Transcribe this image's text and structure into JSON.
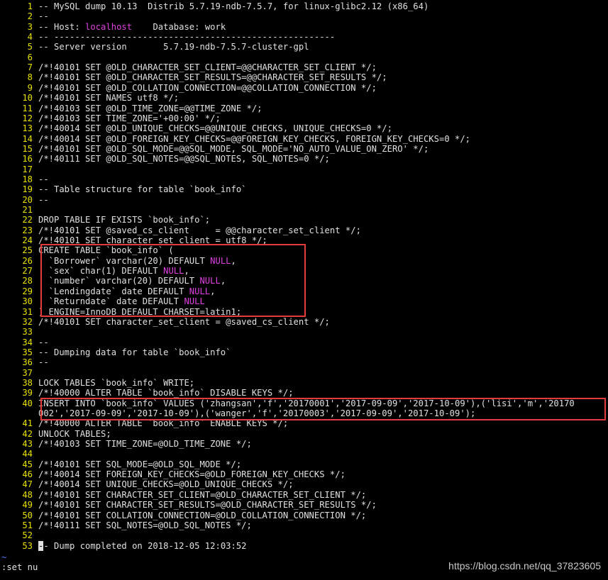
{
  "lines": [
    {
      "n": "1",
      "t": "-- MySQL dump 10.13  Distrib 5.7.19-ndb-7.5.7, for linux-glibc2.12 (x86_64)"
    },
    {
      "n": "2",
      "t": "--"
    },
    {
      "n": "3",
      "t": "-- Host: localhost    Database: work"
    },
    {
      "n": "4",
      "t": "-- ------------------------------------------------------"
    },
    {
      "n": "5",
      "t": "-- Server version       5.7.19-ndb-7.5.7-cluster-gpl"
    },
    {
      "n": "6",
      "t": ""
    },
    {
      "n": "7",
      "t": "/*!40101 SET @OLD_CHARACTER_SET_CLIENT=@@CHARACTER_SET_CLIENT */;"
    },
    {
      "n": "8",
      "t": "/*!40101 SET @OLD_CHARACTER_SET_RESULTS=@@CHARACTER_SET_RESULTS */;"
    },
    {
      "n": "9",
      "t": "/*!40101 SET @OLD_COLLATION_CONNECTION=@@COLLATION_CONNECTION */;"
    },
    {
      "n": "10",
      "t": "/*!40101 SET NAMES utf8 */;"
    },
    {
      "n": "11",
      "t": "/*!40103 SET @OLD_TIME_ZONE=@@TIME_ZONE */;"
    },
    {
      "n": "12",
      "t": "/*!40103 SET TIME_ZONE='+00:00' */;"
    },
    {
      "n": "13",
      "t": "/*!40014 SET @OLD_UNIQUE_CHECKS=@@UNIQUE_CHECKS, UNIQUE_CHECKS=0 */;"
    },
    {
      "n": "14",
      "t": "/*!40014 SET @OLD_FOREIGN_KEY_CHECKS=@@FOREIGN_KEY_CHECKS, FOREIGN_KEY_CHECKS=0 */;"
    },
    {
      "n": "15",
      "t": "/*!40101 SET @OLD_SQL_MODE=@@SQL_MODE, SQL_MODE='NO_AUTO_VALUE_ON_ZERO' */;"
    },
    {
      "n": "16",
      "t": "/*!40111 SET @OLD_SQL_NOTES=@@SQL_NOTES, SQL_NOTES=0 */;"
    },
    {
      "n": "17",
      "t": ""
    },
    {
      "n": "18",
      "t": "--"
    },
    {
      "n": "19",
      "t": "-- Table structure for table `book_info`"
    },
    {
      "n": "20",
      "t": "--"
    },
    {
      "n": "21",
      "t": ""
    },
    {
      "n": "22",
      "t": "DROP TABLE IF EXISTS `book_info`;"
    },
    {
      "n": "23",
      "t": "/*!40101 SET @saved_cs_client     = @@character_set_client */;"
    },
    {
      "n": "24",
      "t": "/*!40101 SET character_set_client = utf8 */;"
    },
    {
      "n": "25",
      "t": "CREATE TABLE `book_info` ("
    },
    {
      "n": "26",
      "t": "  `Borrower` varchar(20) DEFAULT NULL,"
    },
    {
      "n": "27",
      "t": "  `sex` char(1) DEFAULT NULL,"
    },
    {
      "n": "28",
      "t": "  `number` varchar(20) DEFAULT NULL,"
    },
    {
      "n": "29",
      "t": "  `Lendingdate` date DEFAULT NULL,"
    },
    {
      "n": "30",
      "t": "  `Returndate` date DEFAULT NULL"
    },
    {
      "n": "31",
      "t": ") ENGINE=InnoDB DEFAULT CHARSET=latin1;"
    },
    {
      "n": "32",
      "t": "/*!40101 SET character_set_client = @saved_cs_client */;"
    },
    {
      "n": "33",
      "t": ""
    },
    {
      "n": "34",
      "t": "--"
    },
    {
      "n": "35",
      "t": "-- Dumping data for table `book_info`"
    },
    {
      "n": "36",
      "t": "--"
    },
    {
      "n": "37",
      "t": ""
    },
    {
      "n": "38",
      "t": "LOCK TABLES `book_info` WRITE;"
    },
    {
      "n": "39",
      "t": "/*!40000 ALTER TABLE `book_info` DISABLE KEYS */;"
    },
    {
      "n": "40",
      "t": "INSERT INTO `book_info` VALUES ('zhangsan','f','20170001','2017-09-09','2017-10-09'),('lisi','m','20170"
    },
    {
      "n": "",
      "t": "002','2017-09-09','2017-10-09'),('wanger','f','20170003','2017-09-09','2017-10-09');"
    },
    {
      "n": "41",
      "t": "/*!40000 ALTER TABLE `book_info` ENABLE KEYS */;"
    },
    {
      "n": "42",
      "t": "UNLOCK TABLES;"
    },
    {
      "n": "43",
      "t": "/*!40103 SET TIME_ZONE=@OLD_TIME_ZONE */;"
    },
    {
      "n": "44",
      "t": ""
    },
    {
      "n": "45",
      "t": "/*!40101 SET SQL_MODE=@OLD_SQL_MODE */;"
    },
    {
      "n": "46",
      "t": "/*!40014 SET FOREIGN_KEY_CHECKS=@OLD_FOREIGN_KEY_CHECKS */;"
    },
    {
      "n": "47",
      "t": "/*!40014 SET UNIQUE_CHECKS=@OLD_UNIQUE_CHECKS */;"
    },
    {
      "n": "48",
      "t": "/*!40101 SET CHARACTER_SET_CLIENT=@OLD_CHARACTER_SET_CLIENT */;"
    },
    {
      "n": "49",
      "t": "/*!40101 SET CHARACTER_SET_RESULTS=@OLD_CHARACTER_SET_RESULTS */;"
    },
    {
      "n": "50",
      "t": "/*!40101 SET COLLATION_CONNECTION=@OLD_COLLATION_CONNECTION */;"
    },
    {
      "n": "51",
      "t": "/*!40111 SET SQL_NOTES=@OLD_SQL_NOTES */;"
    },
    {
      "n": "52",
      "t": ""
    },
    {
      "n": "53",
      "t": "-- Dump completed on 2018-12-05 12:03:52"
    }
  ],
  "tilde": "~",
  "command_line": ":set nu",
  "watermark": "https://blog.csdn.net/qq_37823605",
  "colors": {
    "line_number": "#e8e000",
    "keyword_null": "#e040e0",
    "highlight_box": "#e23b3b",
    "background": "#000000"
  }
}
